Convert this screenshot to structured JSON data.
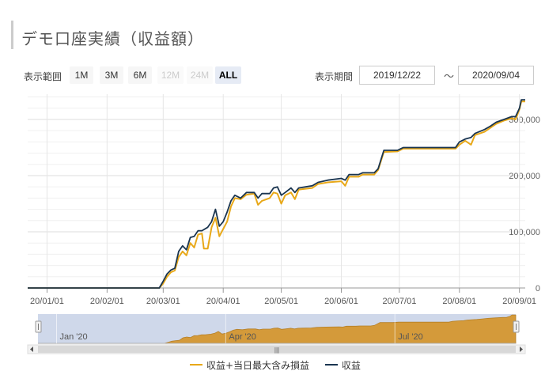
{
  "page": {
    "title": "デモ口座実績（収益額）",
    "range_label": "表示範囲",
    "range_buttons": [
      {
        "label": "1M",
        "state": "normal"
      },
      {
        "label": "3M",
        "state": "normal"
      },
      {
        "label": "6M",
        "state": "normal"
      },
      {
        "label": "12M",
        "state": "disabled"
      },
      {
        "label": "24M",
        "state": "disabled"
      },
      {
        "label": "ALL",
        "state": "selected"
      }
    ],
    "period_label": "表示期間",
    "period_from": "2019/12/22",
    "period_tilde": "〜",
    "period_to": "2020/09/04",
    "navigator_labels": [
      "Jan '20",
      "Apr '20",
      "Jul '20"
    ],
    "scrollbar_grip": "|||"
  },
  "colors": {
    "series_unrealized": "#e8a818",
    "series_profit": "#1a3550",
    "navigator_fill": "#d49a3a",
    "navigator_mask": "#cfd8ea"
  },
  "chart_data": {
    "type": "line",
    "xlabel": "",
    "ylabel": "",
    "x_ticks": [
      "20/01/01",
      "20/02/01",
      "20/03/01",
      "20/04/01",
      "20/05/01",
      "20/06/01",
      "20/07/01",
      "20/08/01",
      "20/09/01"
    ],
    "y_ticks": [
      "0",
      "100,000",
      "200,000",
      "300,000"
    ],
    "ylim": [
      0,
      345000
    ],
    "xlim": [
      "2019-12-22",
      "2020-09-04"
    ],
    "legend_position": "bottom",
    "series": [
      {
        "name": "収益+当日最大含み損益",
        "points": [
          [
            "2019-12-22",
            0
          ],
          [
            "2020-02-28",
            0
          ],
          [
            "2020-03-01",
            8000
          ],
          [
            "2020-03-03",
            20000
          ],
          [
            "2020-03-05",
            28000
          ],
          [
            "2020-03-07",
            31000
          ],
          [
            "2020-03-09",
            55000
          ],
          [
            "2020-03-11",
            65000
          ],
          [
            "2020-03-13",
            58000
          ],
          [
            "2020-03-15",
            80000
          ],
          [
            "2020-03-17",
            72000
          ],
          [
            "2020-03-19",
            95000
          ],
          [
            "2020-03-21",
            97000
          ],
          [
            "2020-03-22",
            70000
          ],
          [
            "2020-03-24",
            70000
          ],
          [
            "2020-03-26",
            108000
          ],
          [
            "2020-03-28",
            125000
          ],
          [
            "2020-03-30",
            92000
          ],
          [
            "2020-04-01",
            105000
          ],
          [
            "2020-04-03",
            118000
          ],
          [
            "2020-04-05",
            145000
          ],
          [
            "2020-04-07",
            160000
          ],
          [
            "2020-04-10",
            158000
          ],
          [
            "2020-04-13",
            166000
          ],
          [
            "2020-04-17",
            168000
          ],
          [
            "2020-04-19",
            148000
          ],
          [
            "2020-04-21",
            155000
          ],
          [
            "2020-04-25",
            160000
          ],
          [
            "2020-04-27",
            170000
          ],
          [
            "2020-04-29",
            168000
          ],
          [
            "2020-05-01",
            150000
          ],
          [
            "2020-05-03",
            165000
          ],
          [
            "2020-05-06",
            170000
          ],
          [
            "2020-05-08",
            158000
          ],
          [
            "2020-05-10",
            175000
          ],
          [
            "2020-05-17",
            178000
          ],
          [
            "2020-05-20",
            185000
          ],
          [
            "2020-05-25",
            188000
          ],
          [
            "2020-06-01",
            190000
          ],
          [
            "2020-06-03",
            182000
          ],
          [
            "2020-06-05",
            198000
          ],
          [
            "2020-06-10",
            198000
          ],
          [
            "2020-06-12",
            202000
          ],
          [
            "2020-06-18",
            202000
          ],
          [
            "2020-06-20",
            210000
          ],
          [
            "2020-06-23",
            242000
          ],
          [
            "2020-06-30",
            243000
          ],
          [
            "2020-07-03",
            248000
          ],
          [
            "2020-07-30",
            248000
          ],
          [
            "2020-08-01",
            255000
          ],
          [
            "2020-08-04",
            262000
          ],
          [
            "2020-08-07",
            255000
          ],
          [
            "2020-08-09",
            272000
          ],
          [
            "2020-08-14",
            278000
          ],
          [
            "2020-08-17",
            285000
          ],
          [
            "2020-08-20",
            292000
          ],
          [
            "2020-08-24",
            298000
          ],
          [
            "2020-08-28",
            302000
          ],
          [
            "2020-08-30",
            300000
          ],
          [
            "2020-09-01",
            318000
          ],
          [
            "2020-09-02",
            332000
          ],
          [
            "2020-09-04",
            332000
          ]
        ]
      },
      {
        "name": "収益",
        "points": [
          [
            "2019-12-22",
            0
          ],
          [
            "2020-02-28",
            0
          ],
          [
            "2020-03-01",
            12000
          ],
          [
            "2020-03-03",
            25000
          ],
          [
            "2020-03-05",
            32000
          ],
          [
            "2020-03-07",
            35000
          ],
          [
            "2020-03-09",
            65000
          ],
          [
            "2020-03-11",
            75000
          ],
          [
            "2020-03-13",
            68000
          ],
          [
            "2020-03-15",
            90000
          ],
          [
            "2020-03-17",
            92000
          ],
          [
            "2020-03-19",
            102000
          ],
          [
            "2020-03-21",
            102000
          ],
          [
            "2020-03-24",
            108000
          ],
          [
            "2020-03-26",
            118000
          ],
          [
            "2020-03-28",
            140000
          ],
          [
            "2020-03-30",
            110000
          ],
          [
            "2020-04-01",
            118000
          ],
          [
            "2020-04-03",
            135000
          ],
          [
            "2020-04-05",
            155000
          ],
          [
            "2020-04-07",
            165000
          ],
          [
            "2020-04-10",
            160000
          ],
          [
            "2020-04-13",
            170000
          ],
          [
            "2020-04-17",
            170000
          ],
          [
            "2020-04-19",
            160000
          ],
          [
            "2020-04-21",
            168000
          ],
          [
            "2020-04-25",
            168000
          ],
          [
            "2020-04-27",
            178000
          ],
          [
            "2020-04-29",
            180000
          ],
          [
            "2020-05-01",
            165000
          ],
          [
            "2020-05-03",
            170000
          ],
          [
            "2020-05-06",
            178000
          ],
          [
            "2020-05-08",
            170000
          ],
          [
            "2020-05-10",
            178000
          ],
          [
            "2020-05-17",
            182000
          ],
          [
            "2020-05-20",
            188000
          ],
          [
            "2020-05-25",
            192000
          ],
          [
            "2020-06-01",
            195000
          ],
          [
            "2020-06-03",
            192000
          ],
          [
            "2020-06-05",
            202000
          ],
          [
            "2020-06-10",
            202000
          ],
          [
            "2020-06-12",
            205000
          ],
          [
            "2020-06-18",
            205000
          ],
          [
            "2020-06-20",
            212000
          ],
          [
            "2020-06-23",
            245000
          ],
          [
            "2020-06-30",
            245000
          ],
          [
            "2020-07-03",
            250000
          ],
          [
            "2020-07-30",
            250000
          ],
          [
            "2020-08-01",
            260000
          ],
          [
            "2020-08-04",
            265000
          ],
          [
            "2020-08-07",
            268000
          ],
          [
            "2020-08-09",
            275000
          ],
          [
            "2020-08-14",
            282000
          ],
          [
            "2020-08-17",
            288000
          ],
          [
            "2020-08-20",
            295000
          ],
          [
            "2020-08-24",
            300000
          ],
          [
            "2020-08-28",
            305000
          ],
          [
            "2020-08-30",
            305000
          ],
          [
            "2020-09-01",
            320000
          ],
          [
            "2020-09-02",
            335000
          ],
          [
            "2020-09-04",
            335000
          ]
        ]
      }
    ]
  }
}
